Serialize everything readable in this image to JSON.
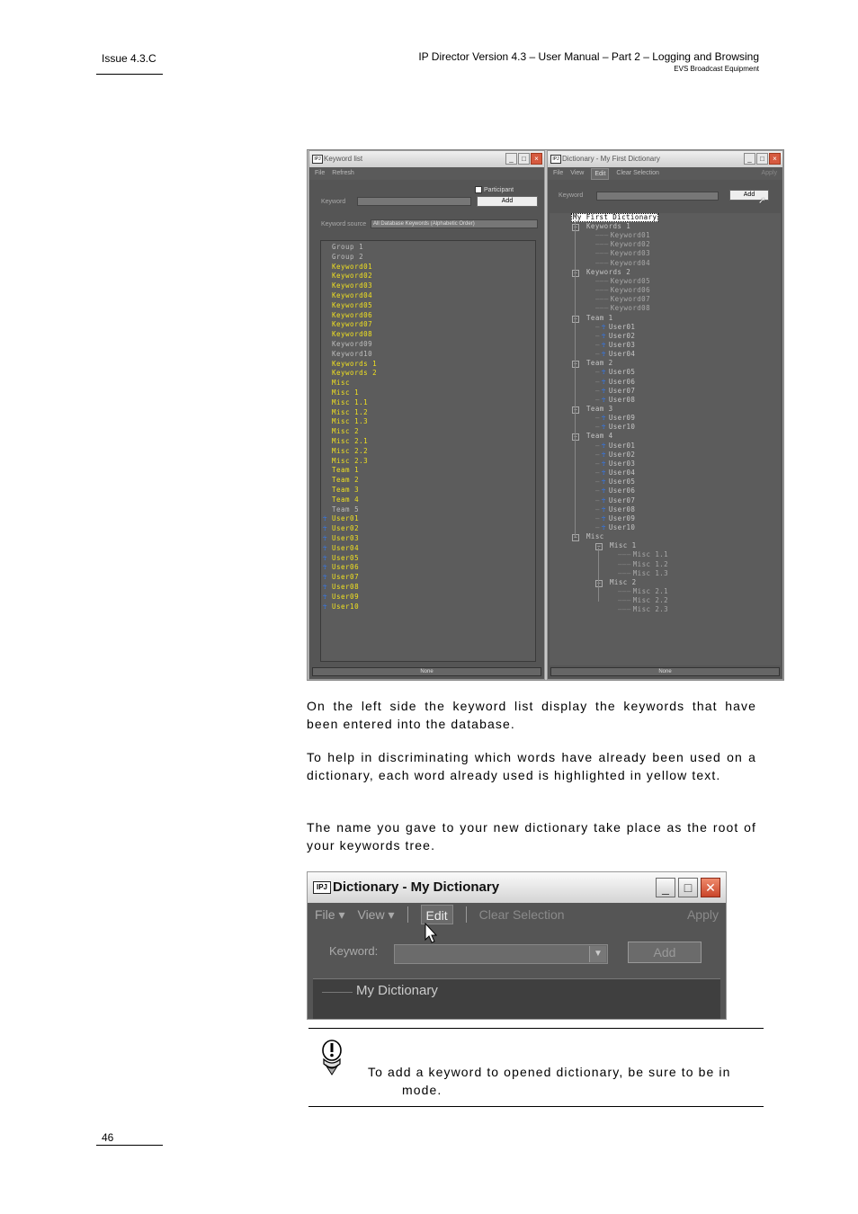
{
  "header": {
    "issue": "Issue 4.3.C",
    "title": "IP Director Version 4.3 – User Manual – Part 2 – Logging and Browsing",
    "company": "EVS Broadcast Equipment"
  },
  "footer": {
    "page_number": "46"
  },
  "shot1": {
    "left_window": {
      "title": "Keyword list",
      "menu": [
        "File",
        "Refresh"
      ],
      "participant_label": "Participant",
      "add_label": "Add",
      "keyword_label": "Keyword",
      "source_label": "Keyword source",
      "source_value": "All Database Keywords (Alphabetic Order)",
      "status": "None",
      "items": [
        {
          "t": "Group 1",
          "used": false,
          "user": false
        },
        {
          "t": "Group 2",
          "used": false,
          "user": false
        },
        {
          "t": "Keyword01",
          "used": true,
          "user": false
        },
        {
          "t": "Keyword02",
          "used": true,
          "user": false
        },
        {
          "t": "Keyword03",
          "used": true,
          "user": false
        },
        {
          "t": "Keyword04",
          "used": true,
          "user": false
        },
        {
          "t": "Keyword05",
          "used": true,
          "user": false
        },
        {
          "t": "Keyword06",
          "used": true,
          "user": false
        },
        {
          "t": "Keyword07",
          "used": true,
          "user": false
        },
        {
          "t": "Keyword08",
          "used": true,
          "user": false
        },
        {
          "t": "Keyword09",
          "used": false,
          "user": false
        },
        {
          "t": "Keyword10",
          "used": false,
          "user": false
        },
        {
          "t": "Keywords 1",
          "used": true,
          "user": false
        },
        {
          "t": "Keywords 2",
          "used": true,
          "user": false
        },
        {
          "t": "Misc",
          "used": true,
          "user": false
        },
        {
          "t": "Misc 1",
          "used": true,
          "user": false
        },
        {
          "t": "Misc 1.1",
          "used": true,
          "user": false
        },
        {
          "t": "Misc 1.2",
          "used": true,
          "user": false
        },
        {
          "t": "Misc 1.3",
          "used": true,
          "user": false
        },
        {
          "t": "Misc 2",
          "used": true,
          "user": false
        },
        {
          "t": "Misc 2.1",
          "used": true,
          "user": false
        },
        {
          "t": "Misc 2.2",
          "used": true,
          "user": false
        },
        {
          "t": "Misc 2.3",
          "used": true,
          "user": false
        },
        {
          "t": "Team 1",
          "used": true,
          "user": false
        },
        {
          "t": "Team 2",
          "used": true,
          "user": false
        },
        {
          "t": "Team 3",
          "used": true,
          "user": false
        },
        {
          "t": "Team 4",
          "used": true,
          "user": false
        },
        {
          "t": "Team 5",
          "used": false,
          "user": false
        },
        {
          "t": "User01",
          "used": true,
          "user": true
        },
        {
          "t": "User02",
          "used": true,
          "user": true
        },
        {
          "t": "User03",
          "used": true,
          "user": true
        },
        {
          "t": "User04",
          "used": true,
          "user": true
        },
        {
          "t": "User05",
          "used": true,
          "user": true
        },
        {
          "t": "User06",
          "used": true,
          "user": true
        },
        {
          "t": "User07",
          "used": true,
          "user": true
        },
        {
          "t": "User08",
          "used": true,
          "user": true
        },
        {
          "t": "User09",
          "used": true,
          "user": true
        },
        {
          "t": "User10",
          "used": true,
          "user": true
        }
      ]
    },
    "right_window": {
      "title": "Dictionary - My First Dictionary",
      "menu": [
        "File",
        "View",
        "Edit",
        "Clear Selection",
        "Apply"
      ],
      "keyword_label": "Keyword",
      "add_label": "Add",
      "status": "None",
      "root": "My First Dictionary",
      "nodes": [
        {
          "t": "Keywords 1",
          "lvl": 1,
          "kind": "group"
        },
        {
          "t": "Keyword01",
          "lvl": 2,
          "kind": "leaf"
        },
        {
          "t": "Keyword02",
          "lvl": 2,
          "kind": "leaf"
        },
        {
          "t": "Keyword03",
          "lvl": 2,
          "kind": "leaf"
        },
        {
          "t": "Keyword04",
          "lvl": 2,
          "kind": "leaf"
        },
        {
          "t": "Keywords 2",
          "lvl": 1,
          "kind": "group"
        },
        {
          "t": "Keyword05",
          "lvl": 2,
          "kind": "leaf"
        },
        {
          "t": "Keyword06",
          "lvl": 2,
          "kind": "leaf"
        },
        {
          "t": "Keyword07",
          "lvl": 2,
          "kind": "leaf"
        },
        {
          "t": "Keyword08",
          "lvl": 2,
          "kind": "leaf"
        },
        {
          "t": "Team 1",
          "lvl": 1,
          "kind": "group"
        },
        {
          "t": "User01",
          "lvl": 2,
          "kind": "user"
        },
        {
          "t": "User02",
          "lvl": 2,
          "kind": "user"
        },
        {
          "t": "User03",
          "lvl": 2,
          "kind": "user"
        },
        {
          "t": "User04",
          "lvl": 2,
          "kind": "user"
        },
        {
          "t": "Team 2",
          "lvl": 1,
          "kind": "group"
        },
        {
          "t": "User05",
          "lvl": 2,
          "kind": "user"
        },
        {
          "t": "User06",
          "lvl": 2,
          "kind": "user"
        },
        {
          "t": "User07",
          "lvl": 2,
          "kind": "user"
        },
        {
          "t": "User08",
          "lvl": 2,
          "kind": "user"
        },
        {
          "t": "Team 3",
          "lvl": 1,
          "kind": "group"
        },
        {
          "t": "User09",
          "lvl": 2,
          "kind": "user"
        },
        {
          "t": "User10",
          "lvl": 2,
          "kind": "user"
        },
        {
          "t": "Team 4",
          "lvl": 1,
          "kind": "group"
        },
        {
          "t": "User01",
          "lvl": 2,
          "kind": "user"
        },
        {
          "t": "User02",
          "lvl": 2,
          "kind": "user"
        },
        {
          "t": "User03",
          "lvl": 2,
          "kind": "user"
        },
        {
          "t": "User04",
          "lvl": 2,
          "kind": "user"
        },
        {
          "t": "User05",
          "lvl": 2,
          "kind": "user"
        },
        {
          "t": "User06",
          "lvl": 2,
          "kind": "user"
        },
        {
          "t": "User07",
          "lvl": 2,
          "kind": "user"
        },
        {
          "t": "User08",
          "lvl": 2,
          "kind": "user"
        },
        {
          "t": "User09",
          "lvl": 2,
          "kind": "user"
        },
        {
          "t": "User10",
          "lvl": 2,
          "kind": "user"
        },
        {
          "t": "Misc",
          "lvl": 1,
          "kind": "group"
        },
        {
          "t": "Misc 1",
          "lvl": 2,
          "kind": "group"
        },
        {
          "t": "Misc 1.1",
          "lvl": 3,
          "kind": "leaf"
        },
        {
          "t": "Misc 1.2",
          "lvl": 3,
          "kind": "leaf"
        },
        {
          "t": "Misc 1.3",
          "lvl": 3,
          "kind": "leaf"
        },
        {
          "t": "Misc 2",
          "lvl": 2,
          "kind": "group"
        },
        {
          "t": "Misc 2.1",
          "lvl": 3,
          "kind": "leaf"
        },
        {
          "t": "Misc 2.2",
          "lvl": 3,
          "kind": "leaf"
        },
        {
          "t": "Misc 2.3",
          "lvl": 3,
          "kind": "leaf"
        }
      ]
    }
  },
  "body": {
    "p1": "On the left side the keyword list display the keywords that have been entered into the database.",
    "p2": "To help in discriminating which words have already been used on a dictionary, each word already used is highlighted in yellow text.",
    "p3": "The name you gave to your new dictionary take place as the root of your keywords tree."
  },
  "shot2": {
    "icon_text": "IPJ",
    "title": "Dictionary - My Dictionary",
    "menu_file": "File",
    "menu_view": "View",
    "menu_edit": "Edit",
    "menu_clear": "Clear Selection",
    "menu_apply": "Apply",
    "keyword_label": "Keyword:",
    "add_label": "Add",
    "root": "My Dictionary"
  },
  "note": {
    "line1": "To add a keyword to opened dictionary, be sure to be in",
    "line2": "mode."
  },
  "colors": {
    "used_keyword": "#f0e020",
    "user_icon": "#2f7cff",
    "window_bg": "#555555"
  }
}
